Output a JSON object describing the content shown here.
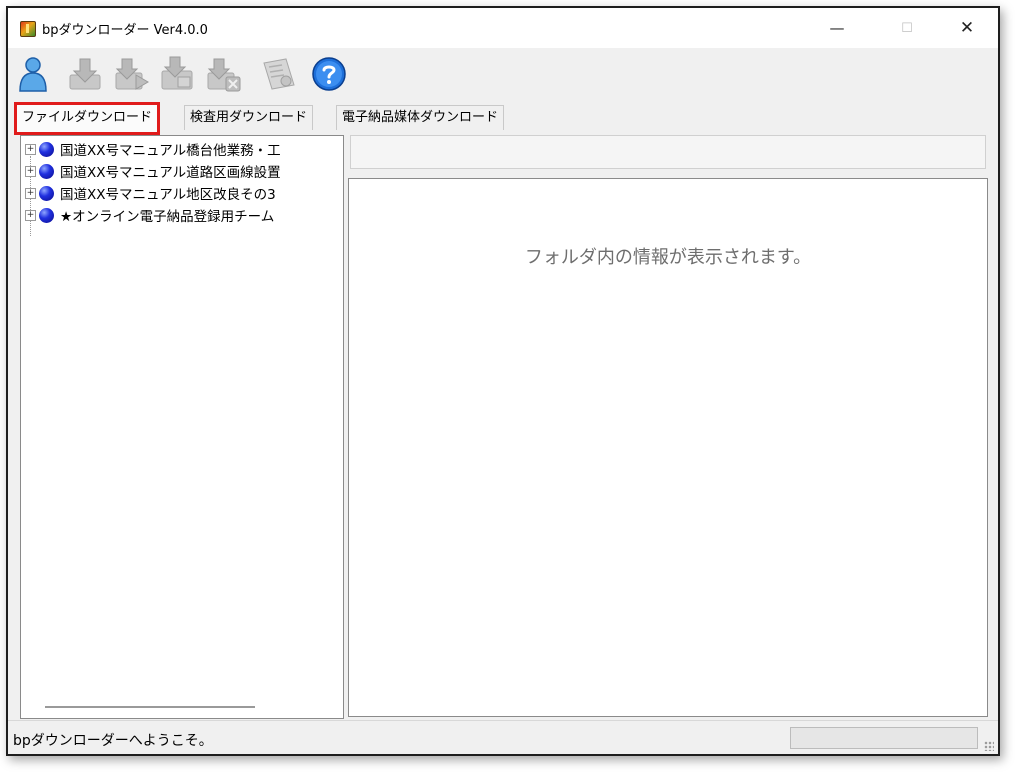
{
  "window": {
    "title": "bpダウンローダー Ver4.0.0",
    "minimize_glyph": "—",
    "maximize_glyph": "☐",
    "close_glyph": "✕"
  },
  "toolbar": {
    "buttons": [
      {
        "icon": "user-icon",
        "enabled": true
      },
      {
        "icon": "download-icon",
        "enabled": false
      },
      {
        "icon": "play-download-icon",
        "enabled": false
      },
      {
        "icon": "download-folder-icon",
        "enabled": false
      },
      {
        "icon": "cancel-download-icon",
        "enabled": false
      },
      {
        "icon": "document-icon",
        "enabled": false
      },
      {
        "icon": "help-icon",
        "enabled": true
      }
    ]
  },
  "tabs": [
    {
      "label": "ファイルダウンロード",
      "active": true
    },
    {
      "label": "検査用ダウンロード",
      "active": false
    },
    {
      "label": "電子納品媒体ダウンロード",
      "active": false
    }
  ],
  "tree": {
    "items": [
      {
        "label": "国道XX号マニュアル橋台他業務・工"
      },
      {
        "label": "国道XX号マニュアル道路区画線設置"
      },
      {
        "label": "国道XX号マニュアル地区改良その3"
      },
      {
        "label": "★オンライン電子納品登録用チーム"
      }
    ]
  },
  "detail": {
    "placeholder": "フォルダ内の情報が表示されます。"
  },
  "status": {
    "message": "bpダウンローダーへようこそ。"
  },
  "colors": {
    "active_tab_outline": "#e01b1b",
    "orb_blue": "#2030e0",
    "help_blue": "#1e6fd9"
  }
}
